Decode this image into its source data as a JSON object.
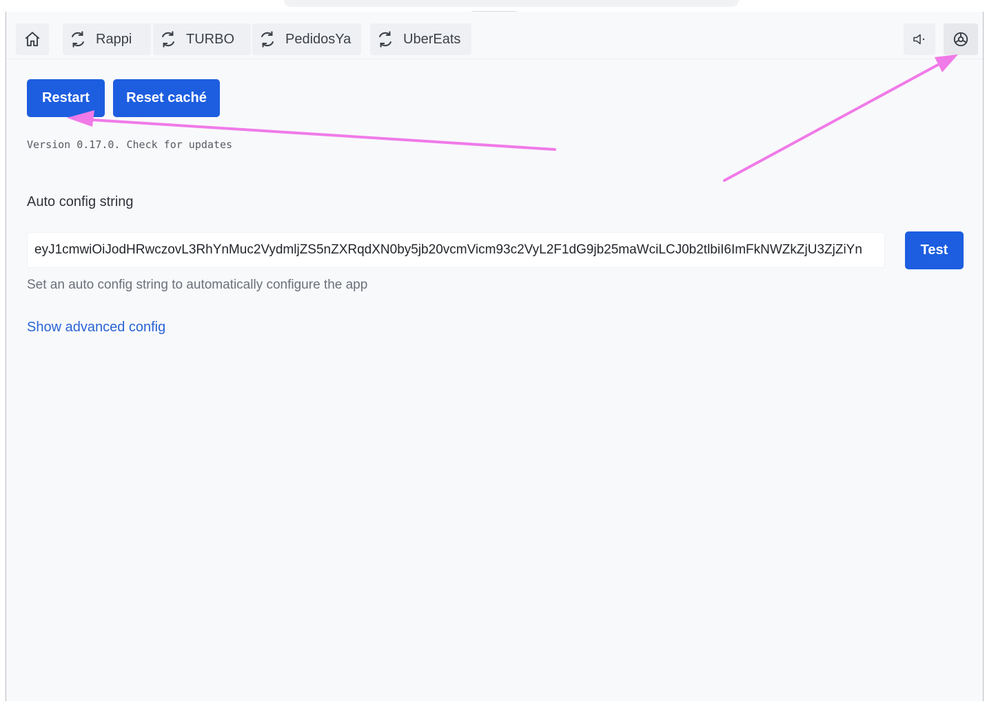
{
  "toolbar": {
    "home_icon": "home-icon",
    "tabs": [
      {
        "label": "Rappi",
        "icon": "refresh-icon"
      },
      {
        "label": "TURBO",
        "icon": "refresh-icon"
      },
      {
        "label": "PedidosYa",
        "icon": "refresh-icon"
      },
      {
        "label": "UberEats",
        "icon": "refresh-icon"
      }
    ],
    "mute_icon": "volume-mute-icon",
    "settings_icon": "gear-icon"
  },
  "actions": {
    "restart_label": "Restart",
    "reset_cache_label": "Reset caché"
  },
  "version_text": "Version 0.17.0. Check for updates",
  "auto_config": {
    "title": "Auto config string",
    "value": "eyJ1cmwiOiJodHRwczovL3RhYnMuc2VydmljZS5nZXRqdXN0by5jb20vcmVicm93c2VyL2F1dG9jb25maWciLCJ0b2tlbiI6ImFkNWZkZjU3ZjZiYn",
    "test_label": "Test",
    "help": "Set an auto config string to automatically configure the app"
  },
  "advanced_link": "Show advanced config",
  "colors": {
    "primary": "#1d5ee0",
    "link": "#2a64d6",
    "annotation_arrow": "#f07ae8",
    "background": "#f8f9fb"
  }
}
